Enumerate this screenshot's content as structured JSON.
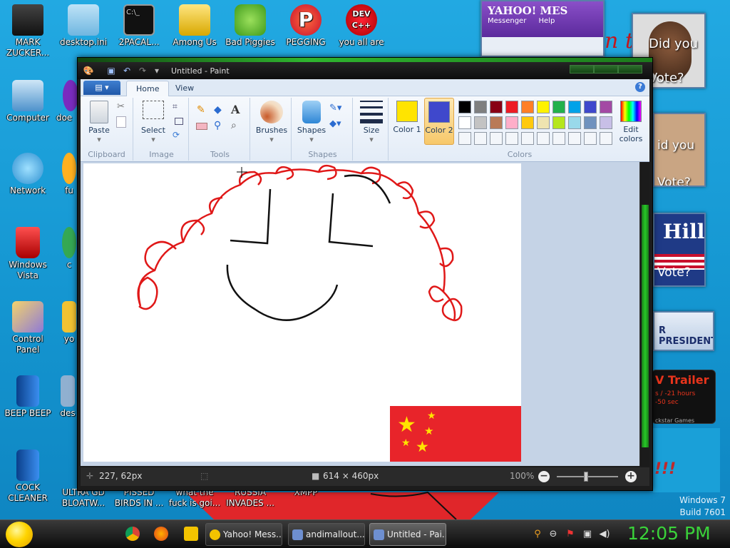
{
  "desktop": {
    "icons": [
      {
        "label": "MARK ZUCKER...",
        "icon": "person-icon",
        "color": "#2b2b2b"
      },
      {
        "label": "desktop.ini",
        "icon": "settings-file-icon",
        "color": "#8fc7e8"
      },
      {
        "label": "2PACAL...",
        "icon": "console-icon",
        "color": "#111111"
      },
      {
        "label": "Among Us",
        "icon": "game-icon",
        "color": "#f0c020"
      },
      {
        "label": "Bad Piggies",
        "icon": "pig-icon",
        "color": "#6cc23a"
      },
      {
        "label": "PEGGING",
        "icon": "p-logo-icon",
        "color": "#e8452c"
      },
      {
        "label": "you all are",
        "icon": "devcpp-icon",
        "color": "#d21a1a"
      },
      {
        "label": "Computer",
        "icon": "computer-icon",
        "color": "#5aa0d8"
      },
      {
        "label": "doe",
        "icon": "document-icon",
        "color": "#7a2bbf"
      },
      {
        "label": "Network",
        "icon": "network-icon",
        "color": "#4aaee8"
      },
      {
        "label": "fu",
        "icon": "app-icon",
        "color": "#ffb020"
      },
      {
        "label": "Windows Vista",
        "icon": "recycle-bin-icon",
        "color": "#d81e1e"
      },
      {
        "label": "c",
        "icon": "app-icon",
        "color": "#35a853"
      },
      {
        "label": "Control Panel",
        "icon": "control-panel-icon",
        "color": "#8e7ad8"
      },
      {
        "label": "yo",
        "icon": "app-icon",
        "color": "#f1c232"
      },
      {
        "label": "BEEP BEEP",
        "icon": "blue-file-icon",
        "color": "#1a6dd0"
      },
      {
        "label": "des",
        "icon": "app-icon",
        "color": "#90b0d0"
      },
      {
        "label": "COCK CLEANER",
        "icon": "blue-file-icon",
        "color": "#1a6dd0"
      },
      {
        "label": "ULTRA GD BLOATW...",
        "icon": "app-icon",
        "color": "#888888"
      },
      {
        "label": "PISSED BIRDS IN ...",
        "icon": "app-icon",
        "color": "#888888"
      },
      {
        "label": "what the fuck is goi...",
        "icon": "app-icon",
        "color": "#888888"
      },
      {
        "label": "RUSSIA INVADES ...",
        "icon": "app-icon",
        "color": "#888888"
      },
      {
        "label": "XMPP",
        "icon": "app-icon",
        "color": "#888888"
      }
    ],
    "popups": {
      "yahoo_title": "YAHOO! MES",
      "yahoo_menu_messenger": "Messenger",
      "yahoo_menu_help": "Help",
      "vote1": "Did you Vote?",
      "vote2": "id you Vote?",
      "vote3_hill": "Hill",
      "vote3": "Vote?",
      "president": "R PRESIDENT",
      "trailer_title": "V Trailer",
      "trailer_line1": "s / -21 hours",
      "trailer_line2": "-50 sec",
      "trailer_line3": "ckstar Games",
      "banner_text": "n t"
    },
    "watermark_os": "Windows 7",
    "watermark_build": "Build 7601"
  },
  "paint": {
    "title": "Untitled - Paint",
    "tabs": [
      "Home",
      "View"
    ],
    "groups": {
      "clipboard": "Clipboard",
      "image": "Image",
      "tools": "Tools",
      "shapes": "Shapes",
      "colors": "Colors"
    },
    "buttons": {
      "paste": "Paste",
      "select": "Select",
      "brushes": "Brushes",
      "shapes": "Shapes",
      "size": "Size",
      "color1": "Color 1",
      "color2": "Color 2",
      "edit_colors": "Edit colors"
    },
    "color1": "#ffe400",
    "color2": "#3f48cc",
    "palette_row1": [
      "#000000",
      "#7f7f7f",
      "#880015",
      "#ed1c24",
      "#ff7f27",
      "#fff200",
      "#22b14c",
      "#00a2e8",
      "#3f48cc",
      "#a349a4"
    ],
    "palette_row2": [
      "#ffffff",
      "#c3c3c3",
      "#b97a57",
      "#ffaec9",
      "#ffc90e",
      "#efe4b0",
      "#b5e61d",
      "#99d9ea",
      "#7092be",
      "#c8bfe7"
    ],
    "status": {
      "cursor_pos": "227, 62px",
      "canvas_size": "614 × 460px",
      "zoom": "100%"
    }
  },
  "taskbar": {
    "buttons": [
      {
        "label": "Yahoo! Mess...",
        "icon": "yahoo-icon",
        "color": "#f3c300"
      },
      {
        "label": "andimallout...",
        "icon": "paint-icon",
        "color": "#6e8fd0"
      },
      {
        "label": "Untitled - Pai...",
        "icon": "paint-icon",
        "color": "#6e8fd0"
      }
    ],
    "clock": "12:05 PM"
  }
}
